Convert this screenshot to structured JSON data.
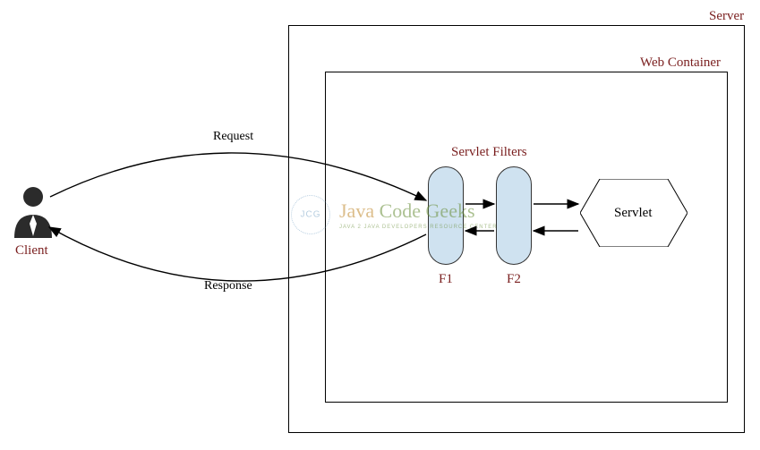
{
  "labels": {
    "server": "Server",
    "web_container": "Web Container",
    "servlet_filters": "Servlet Filters",
    "client": "Client",
    "request": "Request",
    "response": "Response",
    "f1": "F1",
    "f2": "F2",
    "servlet": "Servlet"
  },
  "watermark": {
    "brand_part1": "Java",
    "brand_part2": "Code",
    "brand_part3": "Geeks",
    "tagline": "JAVA 2 JAVA DEVELOPERS RESOURCE CENTER"
  },
  "colors": {
    "title_text": "#7a1f1f",
    "filter_fill": "#cfe2f0",
    "line": "#000000"
  },
  "chart_data": {
    "type": "diagram",
    "nodes": [
      {
        "id": "client",
        "label": "Client",
        "kind": "actor"
      },
      {
        "id": "server",
        "label": "Server",
        "kind": "container"
      },
      {
        "id": "web_container",
        "label": "Web Container",
        "kind": "container",
        "parent": "server"
      },
      {
        "id": "f1",
        "label": "F1",
        "kind": "filter",
        "parent": "web_container",
        "group": "Servlet Filters"
      },
      {
        "id": "f2",
        "label": "F2",
        "kind": "filter",
        "parent": "web_container",
        "group": "Servlet Filters"
      },
      {
        "id": "servlet",
        "label": "Servlet",
        "kind": "servlet",
        "parent": "web_container"
      }
    ],
    "edges": [
      {
        "from": "client",
        "to": "f1",
        "label": "Request",
        "direction": "forward"
      },
      {
        "from": "f1",
        "to": "client",
        "label": "Response",
        "direction": "forward"
      },
      {
        "from": "f1",
        "to": "f2",
        "direction": "forward"
      },
      {
        "from": "f2",
        "to": "f1",
        "direction": "forward"
      },
      {
        "from": "f2",
        "to": "servlet",
        "direction": "forward"
      },
      {
        "from": "servlet",
        "to": "f2",
        "direction": "forward"
      }
    ]
  }
}
